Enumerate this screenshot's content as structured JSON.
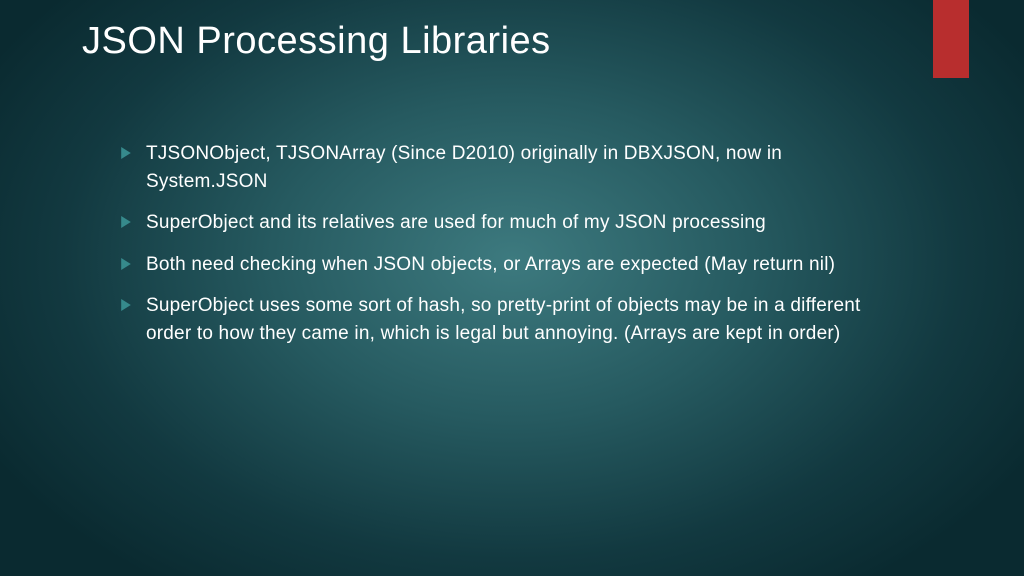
{
  "accent_color": "#b82e2e",
  "marker_color": "#368a8c",
  "title": "JSON Processing Libraries",
  "bullets": [
    "TJSONObject, TJSONArray (Since D2010) originally in DBXJSON, now in System.JSON",
    "SuperObject and its relatives are used for much of my JSON processing",
    "Both need checking when JSON objects, or Arrays are expected (May return nil)",
    "SuperObject uses some sort of hash, so pretty-print of objects may be in a different order to how they came in, which is legal but annoying. (Arrays are kept in order)"
  ]
}
